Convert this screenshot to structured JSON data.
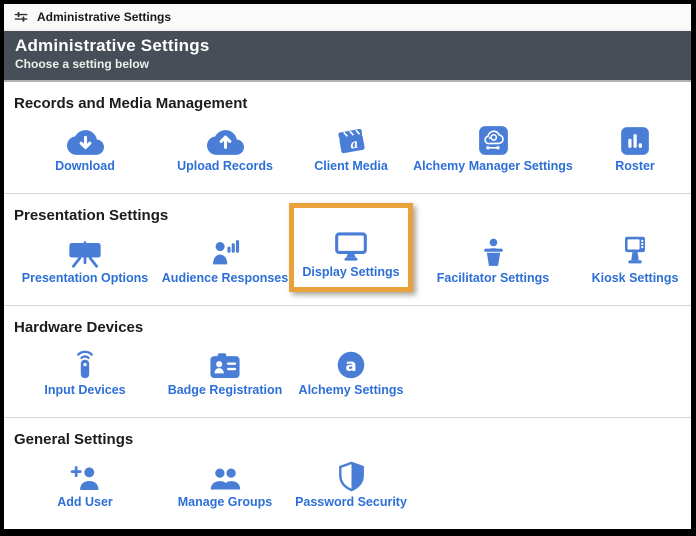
{
  "window": {
    "title": "Administrative Settings"
  },
  "header": {
    "title": "Administrative Settings",
    "subtitle": "Choose a setting below"
  },
  "colors": {
    "header_bg": "#474e57",
    "icon_blue": "#4a7ed6",
    "label_blue": "#2e6fd6",
    "highlight_orange": "#e9a23b"
  },
  "sections": [
    {
      "title": "Records and Media Management",
      "items": [
        {
          "label": "Download",
          "icon": "cloud-download-icon"
        },
        {
          "label": "Upload Records",
          "icon": "cloud-upload-icon"
        },
        {
          "label": "Client Media",
          "icon": "media-clapperboard-icon"
        },
        {
          "label": "Alchemy Manager Settings",
          "icon": "cloud-sync-tile-icon"
        },
        {
          "label": "Roster",
          "icon": "bar-chart-tile-icon"
        }
      ]
    },
    {
      "title": "Presentation Settings",
      "items": [
        {
          "label": "Presentation Options",
          "icon": "projector-screen-icon"
        },
        {
          "label": "Audience Responses",
          "icon": "person-chart-icon"
        },
        {
          "label": "Display Settings",
          "icon": "monitor-icon",
          "highlighted": true
        },
        {
          "label": "Facilitator Settings",
          "icon": "podium-speaker-icon"
        },
        {
          "label": "Kiosk Settings",
          "icon": "kiosk-icon"
        }
      ]
    },
    {
      "title": "Hardware Devices",
      "items": [
        {
          "label": "Input Devices",
          "icon": "remote-control-icon"
        },
        {
          "label": "Badge Registration",
          "icon": "id-badge-icon"
        },
        {
          "label": "Alchemy Settings",
          "icon": "alchemy-logo-icon"
        }
      ]
    },
    {
      "title": "General Settings",
      "items": [
        {
          "label": "Add User",
          "icon": "add-user-icon"
        },
        {
          "label": "Manage Groups",
          "icon": "user-group-icon"
        },
        {
          "label": "Password Security",
          "icon": "shield-icon"
        }
      ]
    }
  ]
}
